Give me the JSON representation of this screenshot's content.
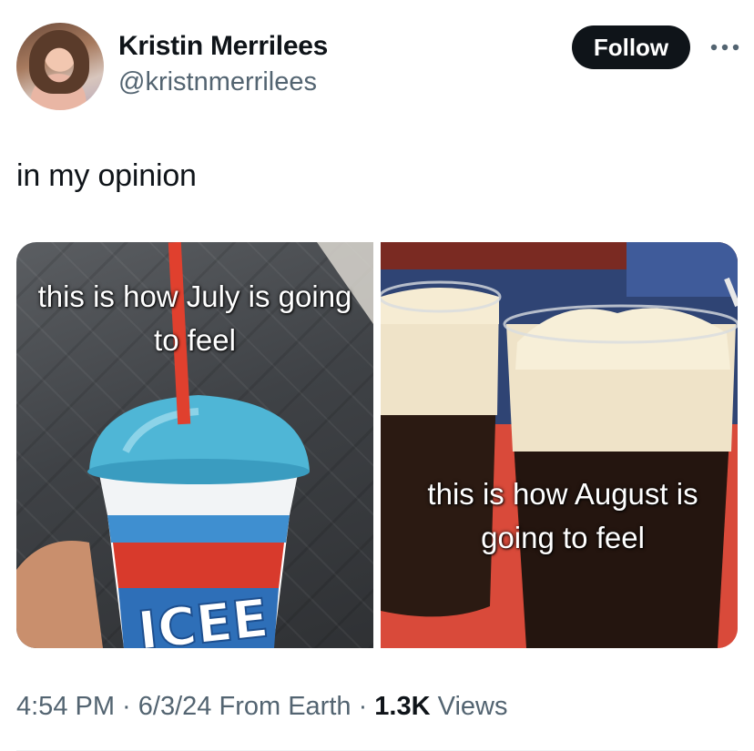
{
  "author": {
    "display_name": "Kristin Merrilees",
    "handle": "@kristnmerrilees"
  },
  "actions": {
    "follow_label": "Follow",
    "more_icon": "more-horizontal-icon"
  },
  "tweet": {
    "text": "in my opinion"
  },
  "media": {
    "left_caption": "this is how July is going to feel",
    "left_cup_text": "ICEE",
    "right_caption": "this is how August is going to feel"
  },
  "meta": {
    "time": "4:54 PM",
    "separator_1": " · ",
    "date": "6/3/24",
    "source": " From Earth",
    "separator_2": " · ",
    "views_count": "1.3K",
    "views_label": " Views"
  },
  "colors": {
    "follow_bg": "#0f1419",
    "secondary_text": "#536471",
    "primary_text": "#0f1419",
    "slushie_blue": "#4fb6d6",
    "straw_red": "#e0402e"
  }
}
